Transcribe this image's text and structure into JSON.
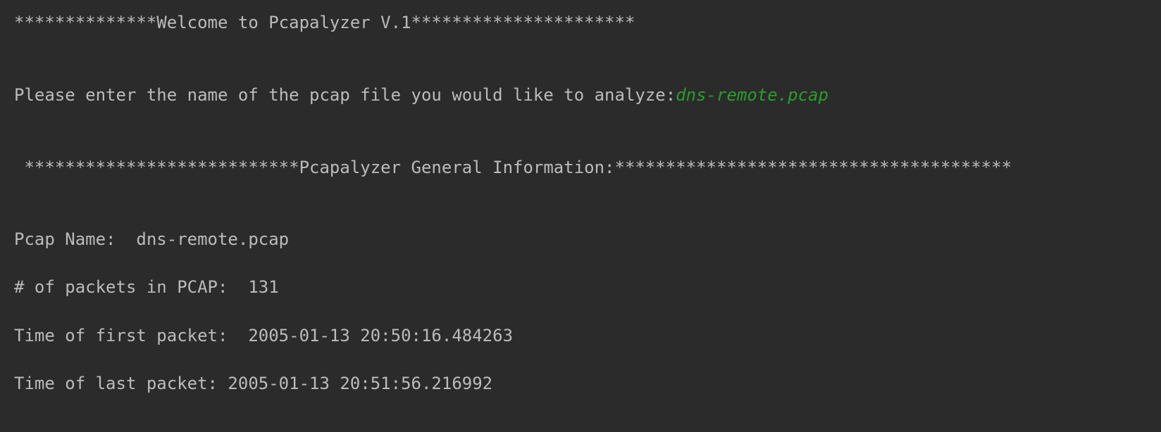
{
  "console": {
    "welcome_line": "**************Welcome to Pcapalyzer V.1**********************",
    "prompt_label": "Please enter the name of the pcap file you would like to analyze:",
    "user_input": "dns-remote.pcap",
    "general_info_header": " ***************************Pcapalyzer General Information:***************************************",
    "pcap_name_line": "Pcap Name:  dns-remote.pcap",
    "packet_count_line": "# of packets in PCAP:  131",
    "first_packet_line": "Time of first packet:  2005-01-13 20:50:16.484263",
    "last_packet_line": "Time of last packet: 2005-01-13 20:51:56.216992"
  },
  "colors": {
    "background": "#2b2b2b",
    "output_text": "#bbbbbb",
    "user_input": "#2a9d2a"
  }
}
